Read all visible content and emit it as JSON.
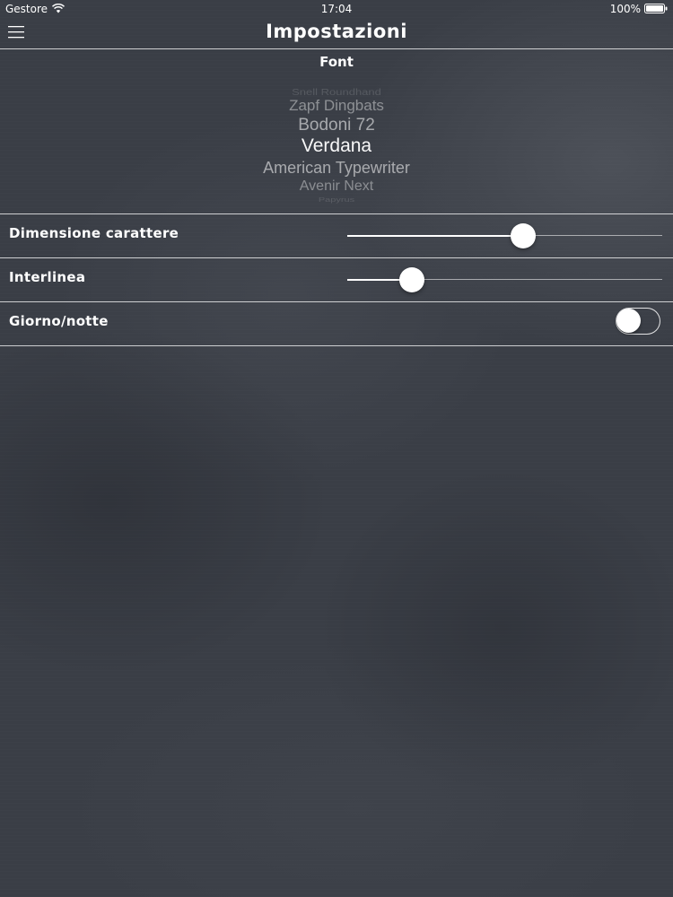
{
  "status_bar": {
    "carrier": "Gestore",
    "time": "17:04",
    "battery_percent": "100%",
    "battery_level": 1.0,
    "icons": [
      "wifi-icon",
      "battery-icon"
    ]
  },
  "nav": {
    "title": "Impostazioni",
    "menu_icon": "menu-icon"
  },
  "font_section": {
    "title": "Font",
    "options": [
      "Snell Roundhand",
      "Zapf Dingbats",
      "Bodoni 72",
      "Verdana",
      "American Typewriter",
      "Avenir Next",
      "Papyrus"
    ],
    "selected": "Verdana"
  },
  "settings": {
    "font_size": {
      "label": "Dimensione carattere",
      "value": 0.558
    },
    "line_spacing": {
      "label": "Interlinea",
      "value": 0.205
    },
    "day_night": {
      "label": "Giorno/notte",
      "on": false
    }
  },
  "colors": {
    "background": "#3a3e46",
    "foreground": "#ffffff"
  }
}
